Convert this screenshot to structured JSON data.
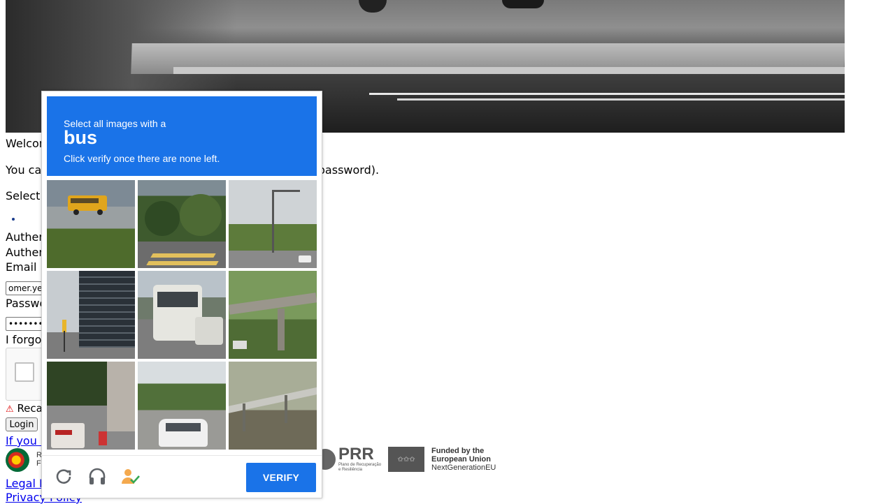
{
  "page": {
    "welcome_text": "Welcome",
    "intro_text": "You can authenticate using your credentials (email and password).",
    "select_text": "Select how you want to authenticate",
    "auth_line1": "Authenticate with Email",
    "auth_line2": "Authenticate with Email",
    "email_label": "Email",
    "email_value": "omer.ye",
    "password_label": "Password",
    "password_value": "••••••••••",
    "forgot_text": "I forgot my password",
    "recaptcha_error": "Recaptcha required",
    "login_label": "Login",
    "help_link": "If you have problems",
    "legal_link": "Legal Notice",
    "privacy_link": "Privacy Policy",
    "pt_text_line1": "R",
    "pt_text_line2": "F",
    "prr_label": "PRR",
    "prr_sub1": "Plano de Recuperação",
    "prr_sub2": "e Resiliência",
    "eu_line1": "Funded by the",
    "eu_line2": "European Union",
    "eu_line3": "NextGenerationEU"
  },
  "captcha": {
    "instruction_line1": "Select all images with a",
    "target": "bus",
    "instruction_line3": "Click verify once there are none left.",
    "verify_label": "VERIFY",
    "colors": {
      "accent": "#1a73e8"
    },
    "tiles": [
      {
        "name": "tile-1",
        "content": "yellow school bus on road"
      },
      {
        "name": "tile-2",
        "content": "trees and crosswalk"
      },
      {
        "name": "tile-3",
        "content": "street light and traffic"
      },
      {
        "name": "tile-4",
        "content": "tall building with traffic light"
      },
      {
        "name": "tile-5",
        "content": "white bus on road"
      },
      {
        "name": "tile-6",
        "content": "overpass with trees"
      },
      {
        "name": "tile-7",
        "content": "street with trees and bus"
      },
      {
        "name": "tile-8",
        "content": "parked white car"
      },
      {
        "name": "tile-9",
        "content": "guardrail on roadside"
      }
    ],
    "footer_icons": [
      "reload-icon",
      "audio-icon",
      "info-icon"
    ]
  }
}
